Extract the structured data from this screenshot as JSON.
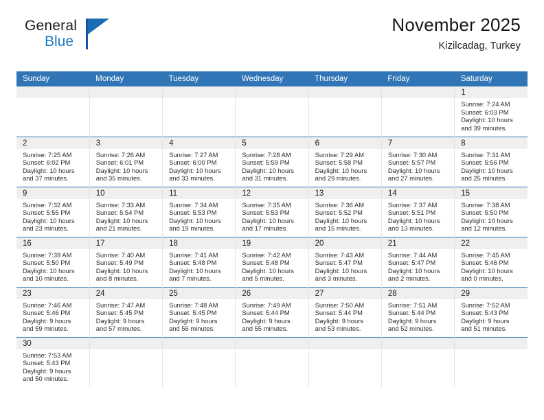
{
  "brand": {
    "name_top": "General",
    "name_bottom": "Blue",
    "flag_icon": "blue-flag-icon",
    "color_dark": "#1c1c1c",
    "color_blue": "#1b7ac4"
  },
  "header": {
    "title": "November 2025",
    "subtitle": "Kizilcadag, Turkey"
  },
  "theme": {
    "header_blue": "#3075b5",
    "daynum_background": "#efefef",
    "text": "#2b2b2b"
  },
  "weekdays": [
    "Sunday",
    "Monday",
    "Tuesday",
    "Wednesday",
    "Thursday",
    "Friday",
    "Saturday"
  ],
  "labels": {
    "sunrise": "Sunrise:",
    "sunset": "Sunset:",
    "daylight": "Daylight:"
  },
  "weeks": [
    [
      {
        "blank": true
      },
      {
        "blank": true
      },
      {
        "blank": true
      },
      {
        "blank": true
      },
      {
        "blank": true
      },
      {
        "blank": true
      },
      {
        "day": "1",
        "sunrise": "Sunrise: 7:24 AM",
        "sunset": "Sunset: 6:03 PM",
        "daylight1": "Daylight: 10 hours",
        "daylight2": "and 39 minutes."
      }
    ],
    [
      {
        "day": "2",
        "sunrise": "Sunrise: 7:25 AM",
        "sunset": "Sunset: 6:02 PM",
        "daylight1": "Daylight: 10 hours",
        "daylight2": "and 37 minutes."
      },
      {
        "day": "3",
        "sunrise": "Sunrise: 7:26 AM",
        "sunset": "Sunset: 6:01 PM",
        "daylight1": "Daylight: 10 hours",
        "daylight2": "and 35 minutes."
      },
      {
        "day": "4",
        "sunrise": "Sunrise: 7:27 AM",
        "sunset": "Sunset: 6:00 PM",
        "daylight1": "Daylight: 10 hours",
        "daylight2": "and 33 minutes."
      },
      {
        "day": "5",
        "sunrise": "Sunrise: 7:28 AM",
        "sunset": "Sunset: 5:59 PM",
        "daylight1": "Daylight: 10 hours",
        "daylight2": "and 31 minutes."
      },
      {
        "day": "6",
        "sunrise": "Sunrise: 7:29 AM",
        "sunset": "Sunset: 5:58 PM",
        "daylight1": "Daylight: 10 hours",
        "daylight2": "and 29 minutes."
      },
      {
        "day": "7",
        "sunrise": "Sunrise: 7:30 AM",
        "sunset": "Sunset: 5:57 PM",
        "daylight1": "Daylight: 10 hours",
        "daylight2": "and 27 minutes."
      },
      {
        "day": "8",
        "sunrise": "Sunrise: 7:31 AM",
        "sunset": "Sunset: 5:56 PM",
        "daylight1": "Daylight: 10 hours",
        "daylight2": "and 25 minutes."
      }
    ],
    [
      {
        "day": "9",
        "sunrise": "Sunrise: 7:32 AM",
        "sunset": "Sunset: 5:55 PM",
        "daylight1": "Daylight: 10 hours",
        "daylight2": "and 23 minutes."
      },
      {
        "day": "10",
        "sunrise": "Sunrise: 7:33 AM",
        "sunset": "Sunset: 5:54 PM",
        "daylight1": "Daylight: 10 hours",
        "daylight2": "and 21 minutes."
      },
      {
        "day": "11",
        "sunrise": "Sunrise: 7:34 AM",
        "sunset": "Sunset: 5:53 PM",
        "daylight1": "Daylight: 10 hours",
        "daylight2": "and 19 minutes."
      },
      {
        "day": "12",
        "sunrise": "Sunrise: 7:35 AM",
        "sunset": "Sunset: 5:53 PM",
        "daylight1": "Daylight: 10 hours",
        "daylight2": "and 17 minutes."
      },
      {
        "day": "13",
        "sunrise": "Sunrise: 7:36 AM",
        "sunset": "Sunset: 5:52 PM",
        "daylight1": "Daylight: 10 hours",
        "daylight2": "and 15 minutes."
      },
      {
        "day": "14",
        "sunrise": "Sunrise: 7:37 AM",
        "sunset": "Sunset: 5:51 PM",
        "daylight1": "Daylight: 10 hours",
        "daylight2": "and 13 minutes."
      },
      {
        "day": "15",
        "sunrise": "Sunrise: 7:38 AM",
        "sunset": "Sunset: 5:50 PM",
        "daylight1": "Daylight: 10 hours",
        "daylight2": "and 12 minutes."
      }
    ],
    [
      {
        "day": "16",
        "sunrise": "Sunrise: 7:39 AM",
        "sunset": "Sunset: 5:50 PM",
        "daylight1": "Daylight: 10 hours",
        "daylight2": "and 10 minutes."
      },
      {
        "day": "17",
        "sunrise": "Sunrise: 7:40 AM",
        "sunset": "Sunset: 5:49 PM",
        "daylight1": "Daylight: 10 hours",
        "daylight2": "and 8 minutes."
      },
      {
        "day": "18",
        "sunrise": "Sunrise: 7:41 AM",
        "sunset": "Sunset: 5:48 PM",
        "daylight1": "Daylight: 10 hours",
        "daylight2": "and 7 minutes."
      },
      {
        "day": "19",
        "sunrise": "Sunrise: 7:42 AM",
        "sunset": "Sunset: 5:48 PM",
        "daylight1": "Daylight: 10 hours",
        "daylight2": "and 5 minutes."
      },
      {
        "day": "20",
        "sunrise": "Sunrise: 7:43 AM",
        "sunset": "Sunset: 5:47 PM",
        "daylight1": "Daylight: 10 hours",
        "daylight2": "and 3 minutes."
      },
      {
        "day": "21",
        "sunrise": "Sunrise: 7:44 AM",
        "sunset": "Sunset: 5:47 PM",
        "daylight1": "Daylight: 10 hours",
        "daylight2": "and 2 minutes."
      },
      {
        "day": "22",
        "sunrise": "Sunrise: 7:45 AM",
        "sunset": "Sunset: 5:46 PM",
        "daylight1": "Daylight: 10 hours",
        "daylight2": "and 0 minutes."
      }
    ],
    [
      {
        "day": "23",
        "sunrise": "Sunrise: 7:46 AM",
        "sunset": "Sunset: 5:46 PM",
        "daylight1": "Daylight: 9 hours",
        "daylight2": "and 59 minutes."
      },
      {
        "day": "24",
        "sunrise": "Sunrise: 7:47 AM",
        "sunset": "Sunset: 5:45 PM",
        "daylight1": "Daylight: 9 hours",
        "daylight2": "and 57 minutes."
      },
      {
        "day": "25",
        "sunrise": "Sunrise: 7:48 AM",
        "sunset": "Sunset: 5:45 PM",
        "daylight1": "Daylight: 9 hours",
        "daylight2": "and 56 minutes."
      },
      {
        "day": "26",
        "sunrise": "Sunrise: 7:49 AM",
        "sunset": "Sunset: 5:44 PM",
        "daylight1": "Daylight: 9 hours",
        "daylight2": "and 55 minutes."
      },
      {
        "day": "27",
        "sunrise": "Sunrise: 7:50 AM",
        "sunset": "Sunset: 5:44 PM",
        "daylight1": "Daylight: 9 hours",
        "daylight2": "and 53 minutes."
      },
      {
        "day": "28",
        "sunrise": "Sunrise: 7:51 AM",
        "sunset": "Sunset: 5:44 PM",
        "daylight1": "Daylight: 9 hours",
        "daylight2": "and 52 minutes."
      },
      {
        "day": "29",
        "sunrise": "Sunrise: 7:52 AM",
        "sunset": "Sunset: 5:43 PM",
        "daylight1": "Daylight: 9 hours",
        "daylight2": "and 51 minutes."
      }
    ],
    [
      {
        "day": "30",
        "sunrise": "Sunrise: 7:53 AM",
        "sunset": "Sunset: 5:43 PM",
        "daylight1": "Daylight: 9 hours",
        "daylight2": "and 50 minutes."
      },
      {
        "blank": true
      },
      {
        "blank": true
      },
      {
        "blank": true
      },
      {
        "blank": true
      },
      {
        "blank": true
      },
      {
        "blank": true
      }
    ]
  ]
}
